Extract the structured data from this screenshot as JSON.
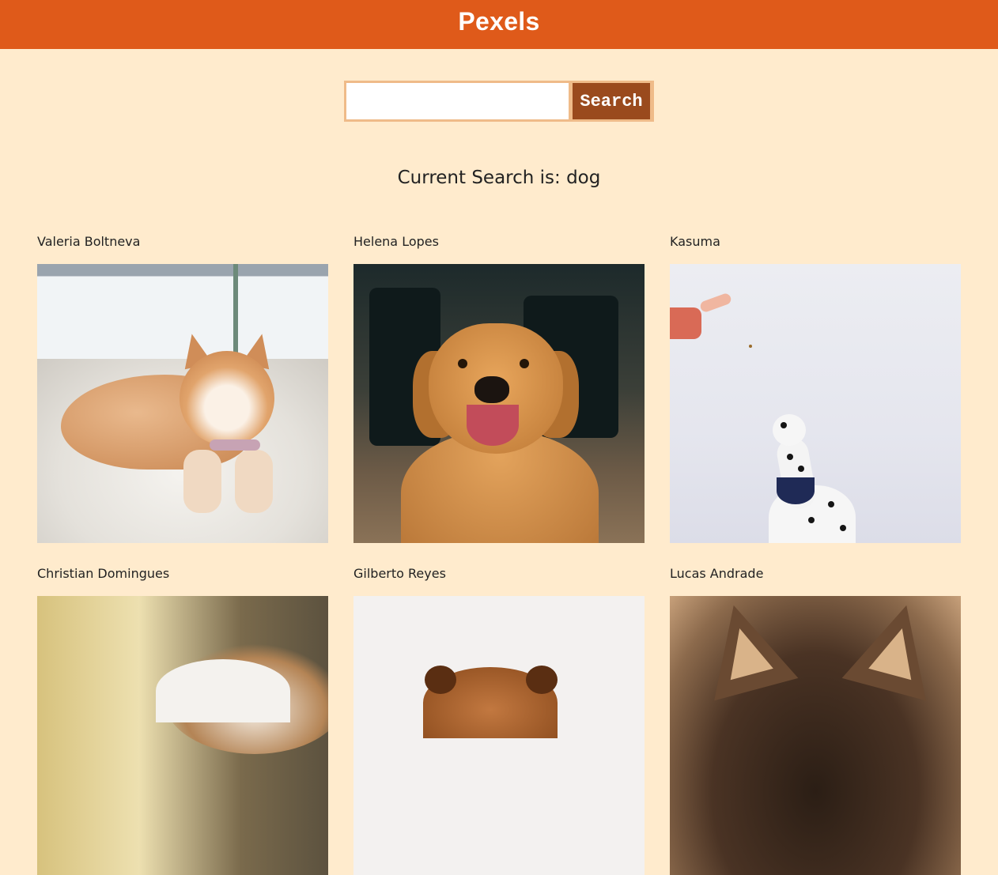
{
  "header": {
    "title": "Pexels"
  },
  "search": {
    "input_value": "",
    "placeholder": "",
    "button_label": "Search"
  },
  "current_search": "Current Search is: dog",
  "photos": [
    {
      "photographer": "Valeria Boltneva"
    },
    {
      "photographer": "Helena Lopes"
    },
    {
      "photographer": "Kasuma"
    },
    {
      "photographer": "Christian Domingues"
    },
    {
      "photographer": "Gilberto Reyes"
    },
    {
      "photographer": "Lucas Andrade"
    }
  ],
  "colors": {
    "header_bg": "#df5a1a",
    "page_bg": "#ffebcd",
    "search_button_bg": "#9a4a1d",
    "search_border": "#efbb89"
  }
}
